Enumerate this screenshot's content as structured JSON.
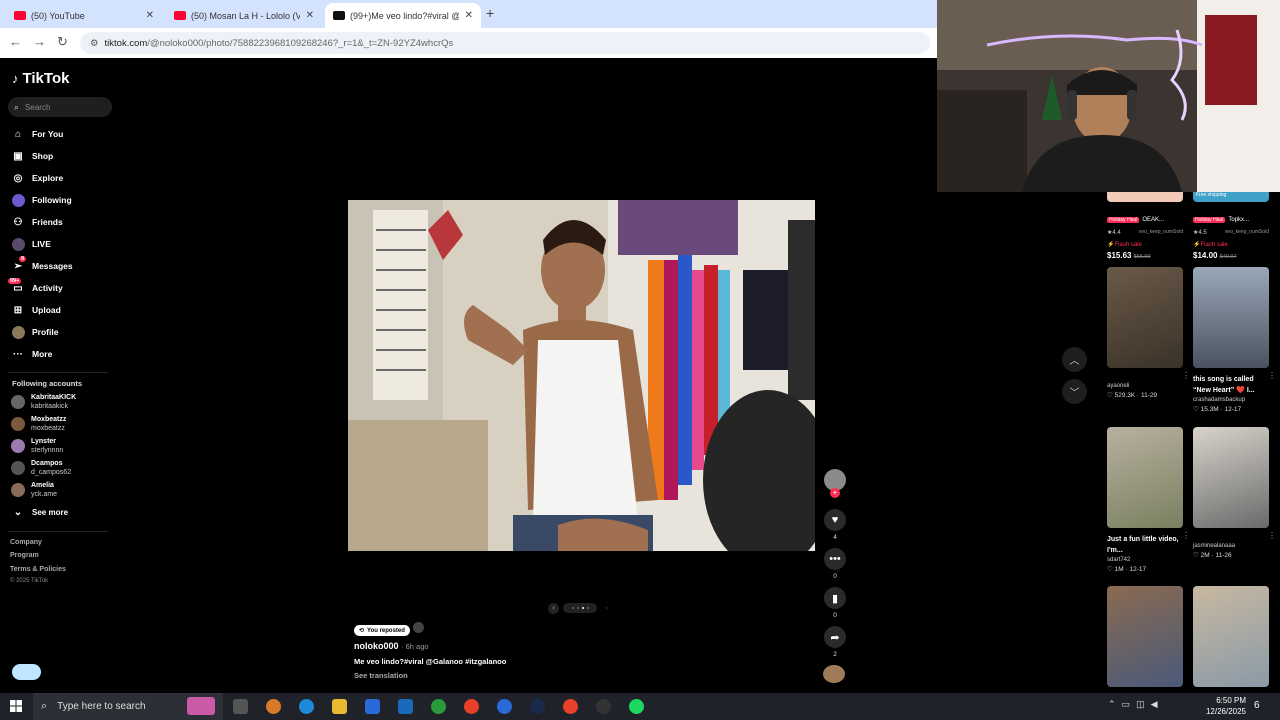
{
  "browser": {
    "tabs": [
      {
        "label": "(50) YouTube",
        "favicon": "youtube-icon"
      },
      {
        "label": "(50) Mosan La H - Lololo (Vide",
        "favicon": "youtube-icon"
      },
      {
        "label": "(99+)Me veo lindo?#viral @Gal",
        "favicon": "tiktok-icon"
      }
    ],
    "url_site": "tiktok.com",
    "url_rest": "/@noloko000/photo/7588223968109268246?_r=1&_t=ZN-92YZ4whcrQs"
  },
  "sidebar": {
    "brand": "TikTok",
    "search_placeholder": "Search",
    "nav": [
      {
        "label": "For You",
        "icon": "home-icon"
      },
      {
        "label": "Shop",
        "icon": "shop-icon"
      },
      {
        "label": "Explore",
        "icon": "compass-icon"
      },
      {
        "label": "Following",
        "icon": "following-avatar-icon"
      },
      {
        "label": "Friends",
        "icon": "friends-icon"
      },
      {
        "label": "LIVE",
        "icon": "live-icon"
      },
      {
        "label": "Messages",
        "icon": "messages-icon",
        "badge": "9"
      },
      {
        "label": "Activity",
        "icon": "activity-icon",
        "badge": "99+"
      },
      {
        "label": "Upload",
        "icon": "upload-icon"
      },
      {
        "label": "Profile",
        "icon": "profile-icon"
      },
      {
        "label": "More",
        "icon": "more-icon"
      }
    ],
    "following_header": "Following accounts",
    "accounts": [
      {
        "name": "KabritaaKICK",
        "handle": "kabritaakick"
      },
      {
        "name": "Moxbeatzz",
        "handle": "moxbeatzz"
      },
      {
        "name": "Lynster",
        "handle": "sterlynnnn"
      },
      {
        "name": "Dcampos",
        "handle": "d_campos62"
      },
      {
        "name": "Amelia",
        "handle": "yck.ame"
      }
    ],
    "see_more": "See more",
    "footer_links": [
      "Company",
      "Program",
      "Terms & Policies"
    ],
    "copyright": "© 2025 TikTok"
  },
  "post": {
    "reposted_label": "You reposted",
    "author": "noloko000",
    "time_ago": "· 6h ago",
    "caption": "Me veo lindo?#viral @Galanoo #itzgalanoo",
    "see_translation": "See translation",
    "likes": "4",
    "comments": "0",
    "saves": "0",
    "shares": "2",
    "carousel_count": 4,
    "carousel_active": 3
  },
  "right_panel": {
    "shop": [
      {
        "tag": "Holiday Haul",
        "name": "OEAK...",
        "rating": "4.4",
        "seller": "veo_keep_numSold",
        "flash": "Flash sale",
        "price": "$15.63",
        "old_price": "$55.00"
      },
      {
        "tag": "Holiday Haul",
        "name": "Topkx...",
        "rating": "4.5",
        "seller": "veo_keep_numSold",
        "flash": "Flash sale",
        "price": "$14.00",
        "old_price": "$49.97",
        "badge": "Free shipping"
      }
    ],
    "videos": [
      {
        "title": "",
        "user": "ayaoneli",
        "likes": "529.3K",
        "date": "11-29"
      },
      {
        "title": "this song is called “New Heart” ❤️ I...",
        "user": "crashadamsbackup",
        "likes": "15.3M",
        "date": "12-17"
      },
      {
        "title": "Just a fun little video, I'm...",
        "user": "sdart742",
        "likes": "1M",
        "date": "12-17"
      },
      {
        "title": "",
        "user": "jasminealanaaa",
        "likes": "2M",
        "date": "11-26"
      }
    ]
  },
  "taskbar": {
    "search_placeholder": "Type here to search",
    "time": "6:50 PM",
    "date": "12/26/2025",
    "notifications": "6"
  }
}
